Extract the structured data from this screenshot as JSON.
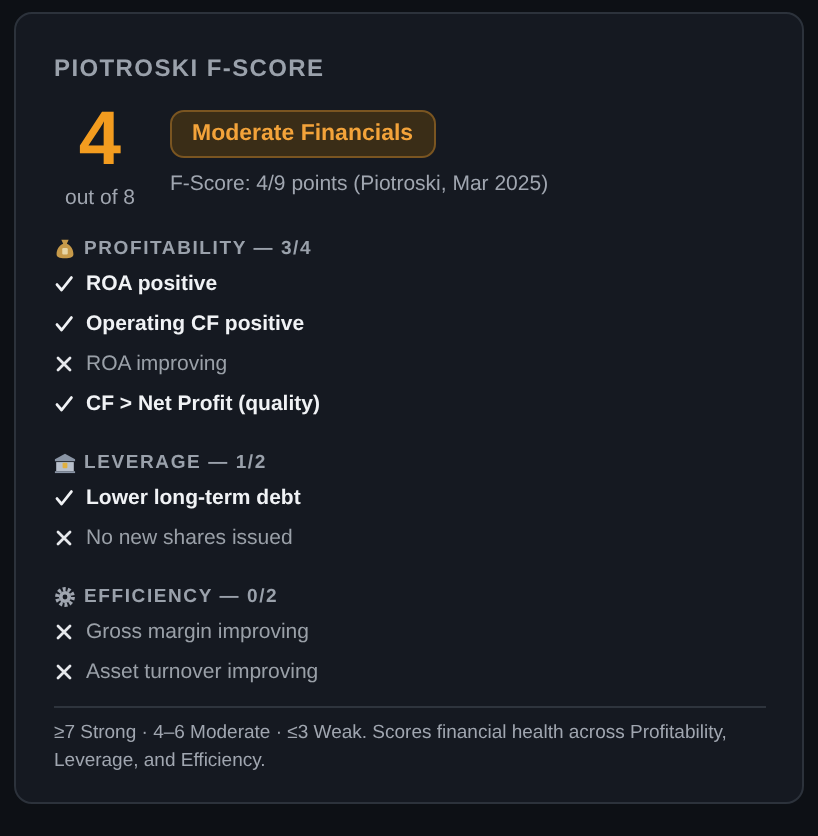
{
  "title": "PIOTROSKI F-SCORE",
  "score": {
    "value": "4",
    "caption": "out of 8"
  },
  "badge": "Moderate Financials",
  "summary": "F-Score: 4/9 points (Piotroski, Mar 2025)",
  "sections": [
    {
      "kind": "profitability",
      "heading": "PROFITABILITY — 3/4",
      "items": [
        {
          "label": "ROA positive",
          "passed": true
        },
        {
          "label": "Operating CF positive",
          "passed": true
        },
        {
          "label": "ROA improving",
          "passed": false
        },
        {
          "label": "CF > Net Profit (quality)",
          "passed": true
        }
      ]
    },
    {
      "kind": "leverage",
      "heading": "LEVERAGE — 1/2",
      "items": [
        {
          "label": "Lower long-term debt",
          "passed": true
        },
        {
          "label": "No new shares issued",
          "passed": false
        }
      ]
    },
    {
      "kind": "efficiency",
      "heading": "EFFICIENCY — 0/2",
      "items": [
        {
          "label": "Gross margin improving",
          "passed": false
        },
        {
          "label": "Asset turnover improving",
          "passed": false
        }
      ]
    }
  ],
  "footnote": "≥7 Strong · 4–6 Moderate · ≤3 Weak. Scores financial health across Profitability, Leverage, and Efficiency."
}
